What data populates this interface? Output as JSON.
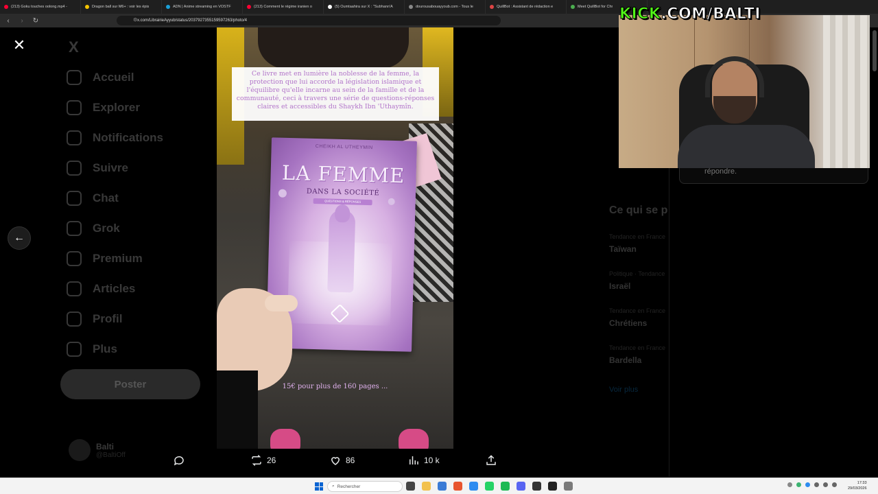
{
  "browser": {
    "tabs": [
      {
        "label": "(213) Goku touches oolong.mp4 -",
        "color": "#ff0033"
      },
      {
        "label": "Dragon ball sur M6+ : voir les épis",
        "color": "#f5c400"
      },
      {
        "label": "ADN | Anime streaming en VOSTF",
        "color": "#1aa0d8"
      },
      {
        "label": "(213) Comment le régime iranien o",
        "color": "#ff0033"
      },
      {
        "label": "(5) Oumtaahira sur X : \"Subhann'A",
        "color": "#ffffff"
      },
      {
        "label": "dourousabouayyoub.com - Tous le",
        "color": "#888888"
      },
      {
        "label": "QuillBot : Assistant de rédaction e",
        "color": "#d44"
      },
      {
        "label": "Meet QuillBot for Chr",
        "color": "#4caf50"
      }
    ],
    "url": "x.com/LibrairieAyyub/status/2037927355159597263/photo/4"
  },
  "sidebar": {
    "logo": "X",
    "items": [
      {
        "label": "Accueil"
      },
      {
        "label": "Explorer"
      },
      {
        "label": "Notifications"
      },
      {
        "label": "Suivre"
      },
      {
        "label": "Chat"
      },
      {
        "label": "Grok"
      },
      {
        "label": "Premium"
      },
      {
        "label": "Articles"
      },
      {
        "label": "Profil"
      },
      {
        "label": "Plus"
      }
    ],
    "post_button": "Poster",
    "profile_name": "Balti",
    "profile_handle": "@BaltiOff"
  },
  "right_column": {
    "reply_text": "répondre.",
    "trends_title": "Ce qui se p",
    "trends": [
      {
        "context": "Tendance en France",
        "name": "Taïwan"
      },
      {
        "context": "Politique · Tendance",
        "name": "Israël"
      },
      {
        "context": "Tendance en France",
        "name": "Chrétiens"
      },
      {
        "context": "Tendance en France",
        "name": "Bardella"
      }
    ],
    "see_more": "Voir plus"
  },
  "photo": {
    "caption": "Ce livre met en lumière la noblesse de la femme, la protection que lui accorde la législation islamique et l'équilibre qu'elle incarne au sein de la famille et de la communauté, ceci à travers une série de questions-réponses claires et accessibles du Shaykh Ibn 'Uthaymîn.",
    "price_text": "15€ pour plus de 160 pages ...",
    "book": {
      "author": "CHEIKH AL UTHEYMIN",
      "title_main": "LA FEMME",
      "title_sub": "DANS LA SOCIÉTÉ",
      "ribbon": "QUESTIONS & RÉPONSES"
    }
  },
  "actions": {
    "retweets": "26",
    "likes": "86",
    "views": "10 k"
  },
  "stream_overlay": {
    "kick_prefix": "KICK",
    "kick_suffix": ".COM/BALTI"
  },
  "taskbar": {
    "search_placeholder": "Rechercher",
    "time": "17:33",
    "date": "29/03/2026"
  }
}
